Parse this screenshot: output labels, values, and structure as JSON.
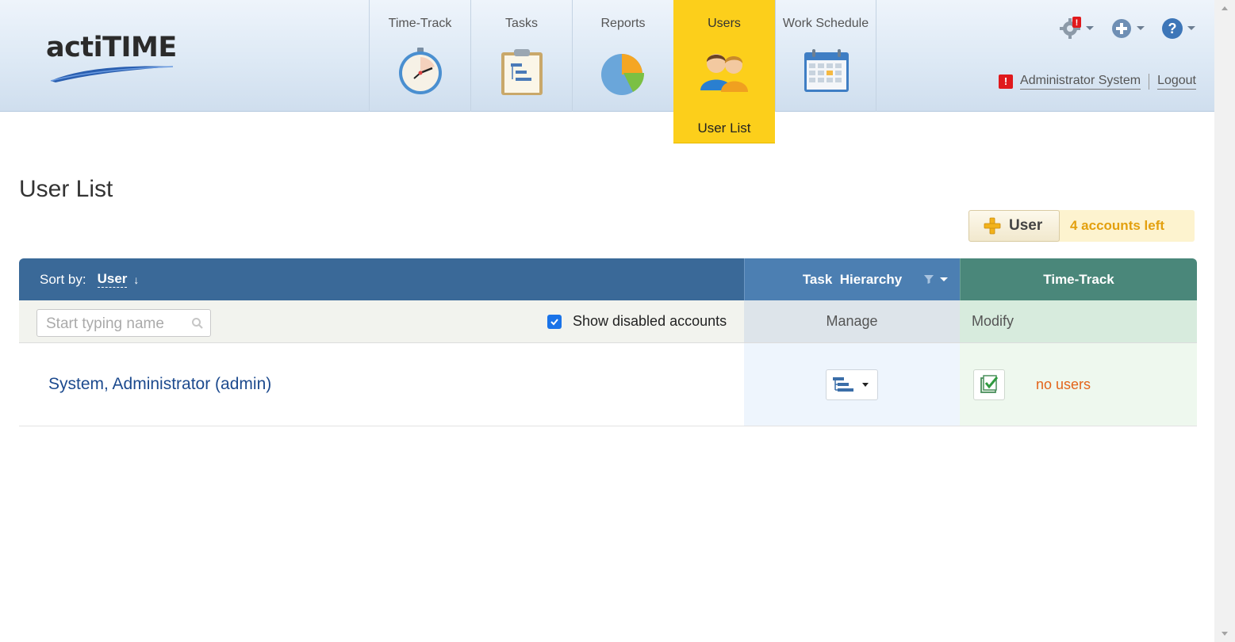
{
  "app": {
    "logo_text": "actiTIME"
  },
  "nav": {
    "items": [
      {
        "label": "Time-Track",
        "icon": "stopwatch-icon"
      },
      {
        "label": "Tasks",
        "icon": "clipboard-tasks-icon"
      },
      {
        "label": "Reports",
        "icon": "pie-chart-icon"
      },
      {
        "label": "Users",
        "icon": "users-icon",
        "active": true,
        "sub_label": "User List"
      },
      {
        "label": "Work Schedule",
        "icon": "calendar-icon"
      }
    ]
  },
  "header": {
    "alert_badge": "!",
    "user_name": "Administrator System",
    "logout_label": "Logout",
    "icons": [
      "settings-gear-icon",
      "add-circle-icon",
      "help-circle-icon"
    ]
  },
  "page": {
    "title": "User List",
    "add_user_label": "User",
    "accounts_left": "4 accounts left"
  },
  "table": {
    "sort_by_label": "Sort by:",
    "sort_by_value": "User",
    "col_task_hierarchy": "Task  Hierarchy",
    "col_time_track": "Time-Track",
    "search_placeholder": "Start typing name",
    "show_disabled_label": "Show disabled accounts",
    "show_disabled_checked": true,
    "manage_label": "Manage",
    "modify_label": "Modify",
    "rows": [
      {
        "user": "System, Administrator (admin)",
        "time_track_status": "no users"
      }
    ]
  },
  "colors": {
    "active_nav": "#fccf1b",
    "header_blue": "#3a6998",
    "task_blue": "#4c7fb2",
    "time_green": "#4a877a",
    "accounts_left_text": "#e3a00e",
    "no_users_text": "#e3641a",
    "alert_red": "#e0191c"
  }
}
